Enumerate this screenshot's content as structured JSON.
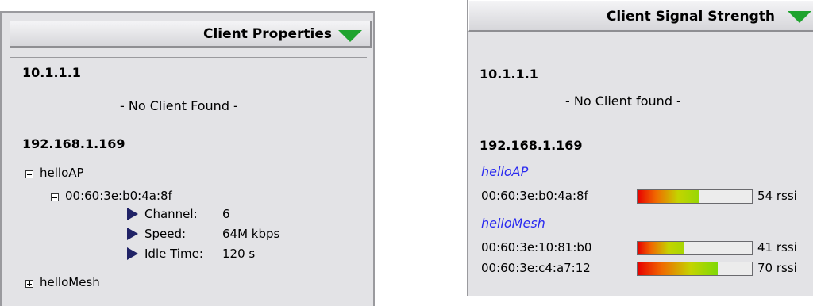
{
  "left_panel": {
    "title": "Client Properties",
    "toggle_icon": "triangle-down-icon",
    "groups": [
      {
        "ip": "10.1.1.1",
        "message": "- No Client Found -"
      },
      {
        "ip": "192.168.1.169"
      }
    ],
    "tree": {
      "ap_name": "helloAP",
      "mac": "00:60:3e:b0:4a:8f",
      "props": [
        {
          "label": "Channel:",
          "value": "6"
        },
        {
          "label": "Speed:",
          "value": "64M kbps"
        },
        {
          "label": "Idle Time:",
          "value": "120 s"
        }
      ],
      "mesh_name": "helloMesh"
    }
  },
  "right_panel": {
    "title": "Client Signal Strength",
    "toggle_icon": "triangle-down-icon",
    "groups": [
      {
        "ip": "10.1.1.1",
        "message": "- No Client found -"
      },
      {
        "ip": "192.168.1.169"
      }
    ],
    "ssids": [
      {
        "name": "helloAP",
        "clients": [
          {
            "mac": "00:60:3e:b0:4a:8f",
            "rssi_label": "54 rssi",
            "level": 0.54
          }
        ]
      },
      {
        "name": "helloMesh",
        "clients": [
          {
            "mac": "00:60:3e:10:81:b0",
            "rssi_label": "41 rssi",
            "level": 0.41
          },
          {
            "mac": "00:60:3e:c4:a7:12",
            "rssi_label": "70 rssi",
            "level": 0.7
          }
        ]
      }
    ],
    "colors": {
      "bar_low": "#e80000",
      "bar_high": "#22e011",
      "ssid": "#2a2af0"
    }
  }
}
